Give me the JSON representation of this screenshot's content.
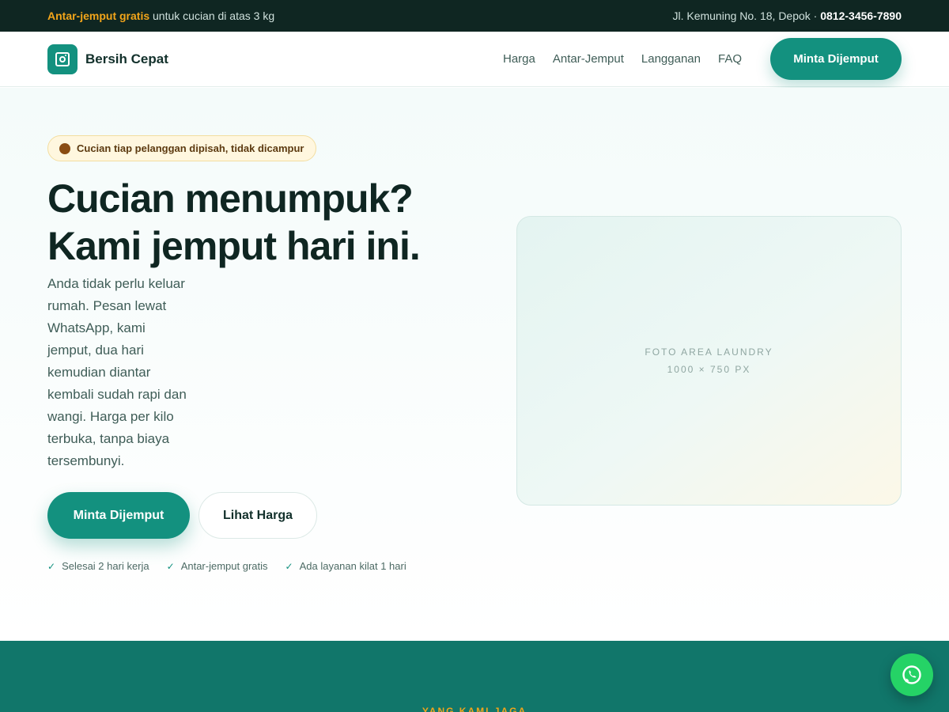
{
  "topbar": {
    "promo_accent": "Antar-jemput gratis",
    "promo_text": " untuk cucian di atas 3 kg",
    "address": "Jl. Kemuning No. 18, Depok · ",
    "phone": "0812-3456-7890"
  },
  "nav": {
    "brand": "Bersih Cepat",
    "items": [
      {
        "label": "Harga"
      },
      {
        "label": "Antar-Jemput"
      },
      {
        "label": "Langganan"
      },
      {
        "label": "FAQ"
      }
    ],
    "cta": "Minta Dijemput"
  },
  "hero": {
    "badge": "Cucian tiap pelanggan dipisah, tidak dicampur",
    "headline_line1": "Cucian menumpuk?",
    "headline_line2": "Kami jemput hari ini.",
    "lead": "Anda tidak perlu keluar rumah. Pesan lewat WhatsApp, kami jemput, dua hari kemudian diantar kembali sudah rapi dan wangi. Harga per kilo terbuka, tanpa biaya tersembunyi.",
    "primary_button": "Minta Dijemput",
    "secondary_button": "Lihat Harga",
    "checks": [
      {
        "label": "Selesai 2 hari kerja"
      },
      {
        "label": "Antar-jemput gratis"
      },
      {
        "label": "Ada layanan kilat 1 hari"
      }
    ],
    "photo_placeholder_title": "FOTO AREA LAUNDRY",
    "photo_placeholder_size": "1000 × 750 PX"
  },
  "section": {
    "eyebrow": "YANG KAMI JAGA"
  },
  "colors": {
    "brand": "#13917f",
    "accent": "#f2a51a",
    "dark": "#0f2622",
    "whatsapp": "#25d366"
  },
  "icons": {
    "logo": "washing-machine-icon",
    "badge": "dot-icon",
    "check": "check-icon",
    "floating": "whatsapp-icon"
  }
}
